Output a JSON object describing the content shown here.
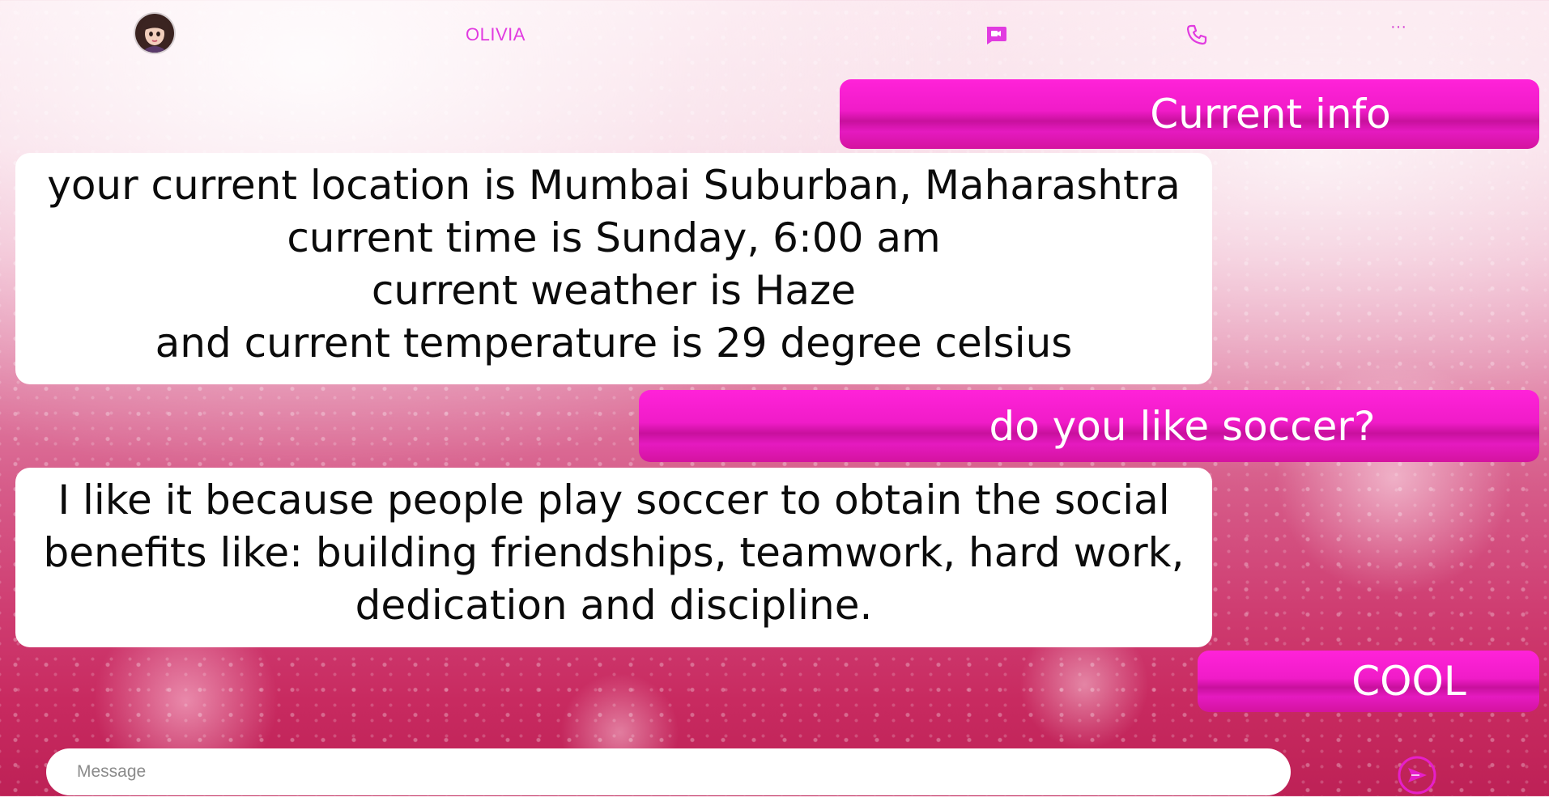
{
  "header": {
    "contact_name": "OLIVIA",
    "avatar_icon": "avatar-icon",
    "video_call_icon": "video-call-icon",
    "phone_icon": "phone-icon",
    "more_icon_glyph": "···"
  },
  "messages": [
    {
      "sender": "user",
      "text": "Current info"
    },
    {
      "sender": "bot",
      "lines": [
        "your current location is Mumbai Suburban, Maharashtra",
        "current time is Sunday, 6:00 am",
        "current weather is Haze",
        "and current temperature is 29 degree celsius"
      ]
    },
    {
      "sender": "user",
      "text": "do you like soccer?"
    },
    {
      "sender": "bot",
      "lines": [
        "I like it because people play soccer to obtain the social",
        "benefits like: building friendships, teamwork, hard work,",
        "dedication and discipline."
      ]
    },
    {
      "sender": "user",
      "text": "COOL"
    }
  ],
  "composer": {
    "placeholder": "Message",
    "value": "",
    "send_icon": "send-icon"
  },
  "colors": {
    "accent": "#e13be0",
    "user_bubble": "#f01cc8",
    "bot_bubble": "#ffffff"
  }
}
